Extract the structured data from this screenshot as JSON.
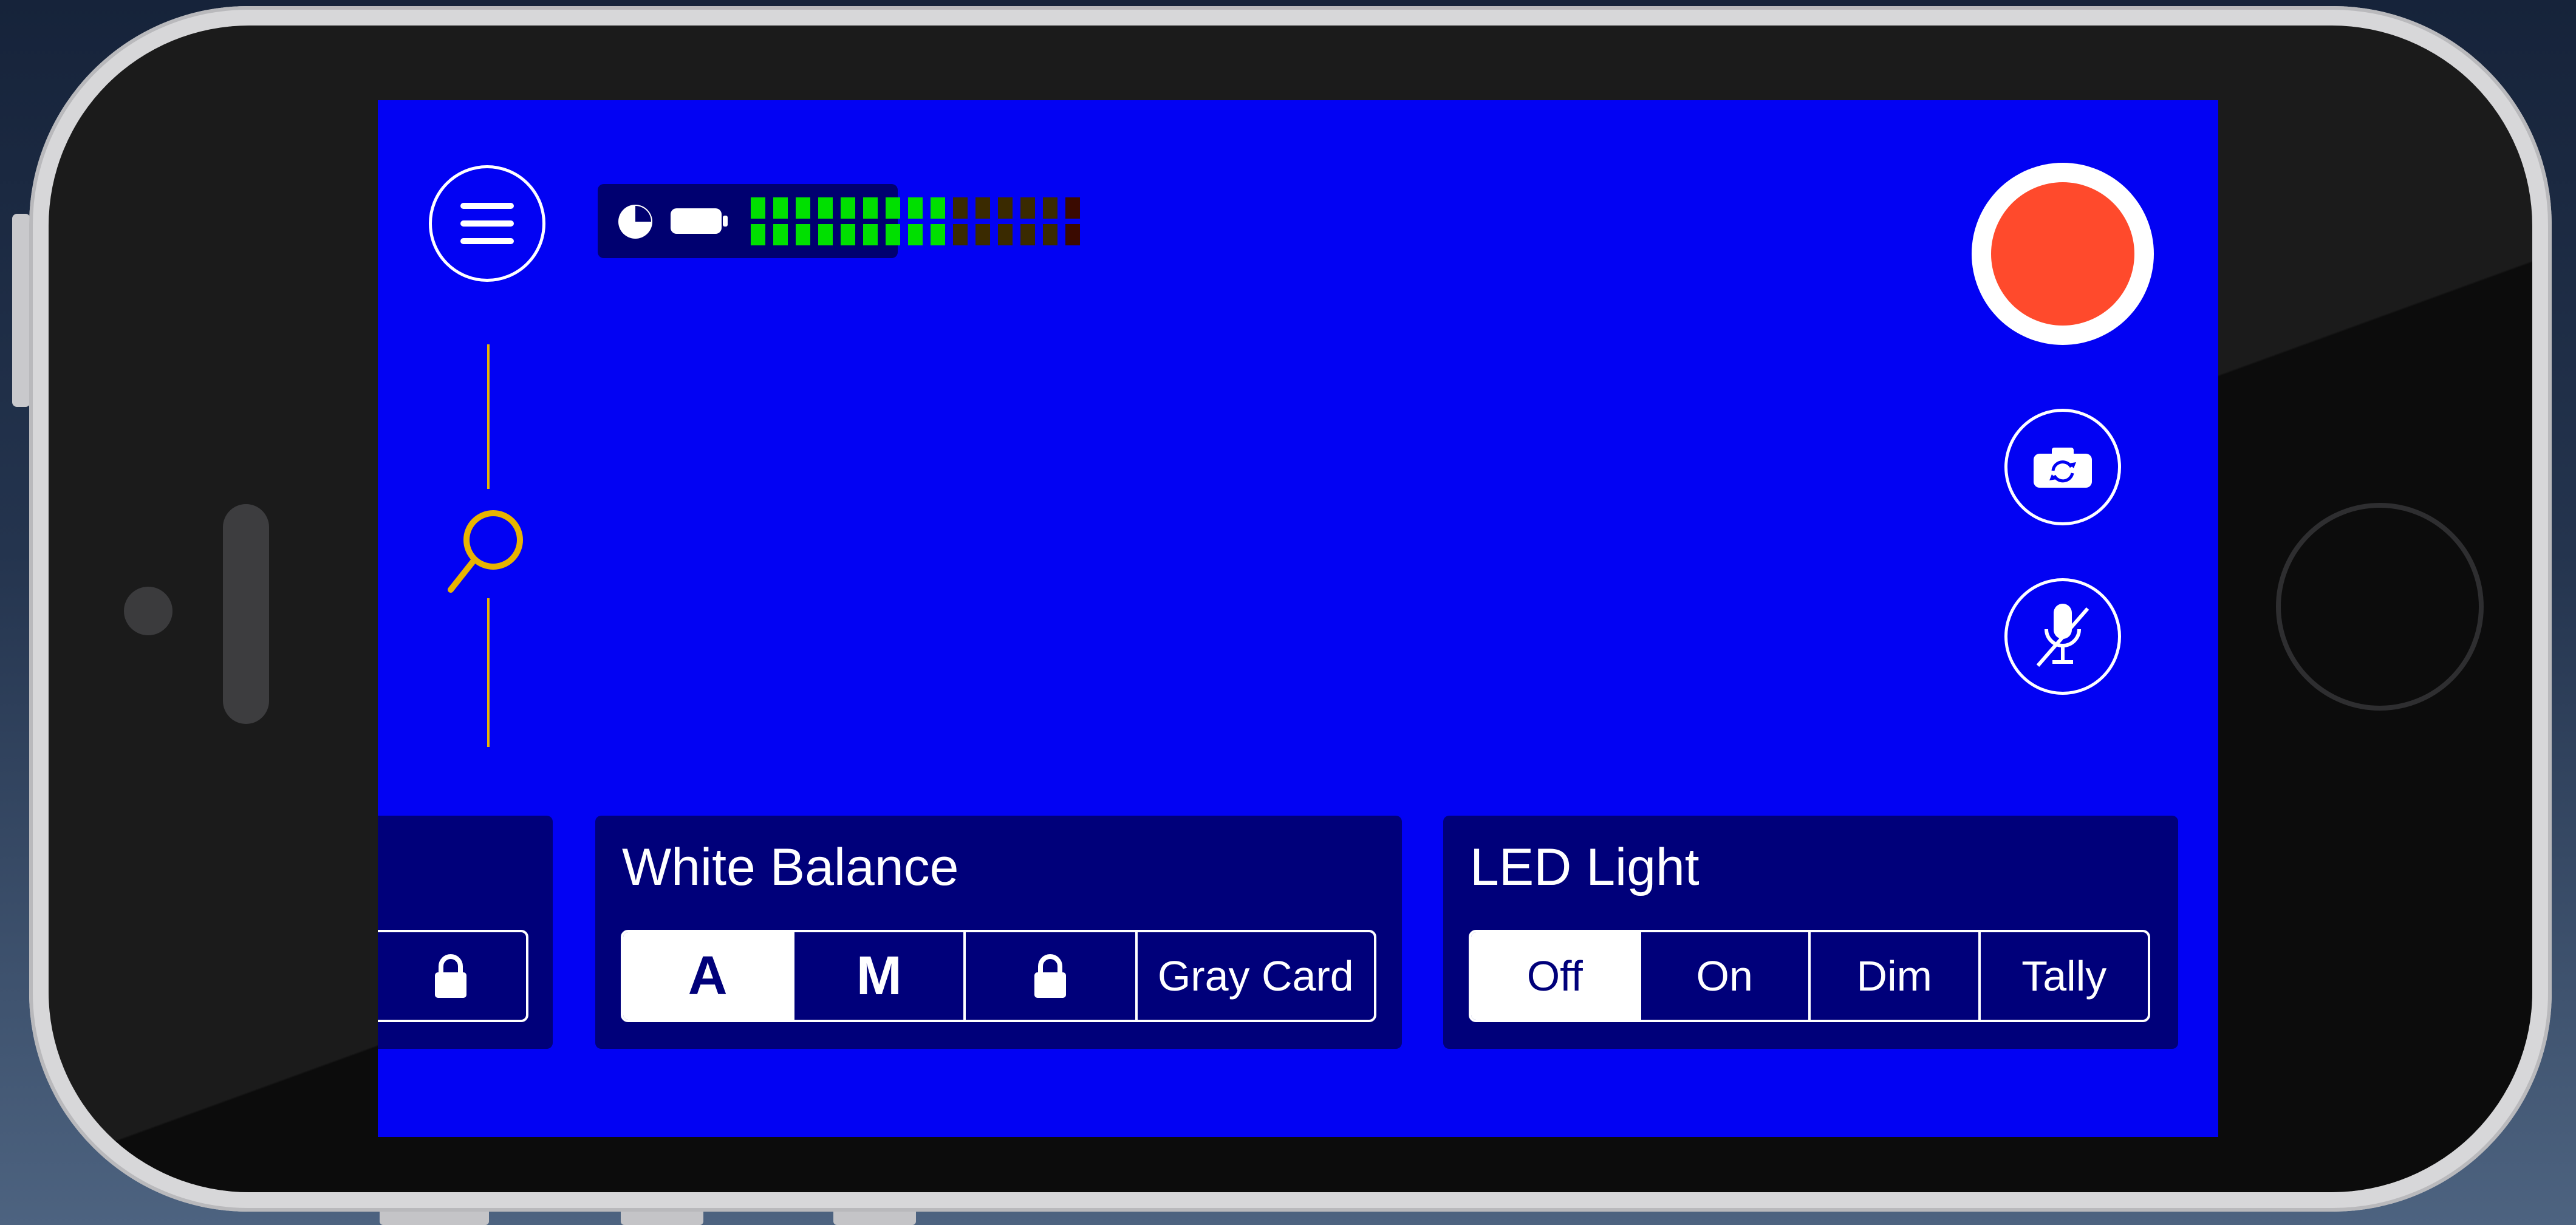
{
  "colors": {
    "screen_background": "#0202f3",
    "panel_background": "#00007a",
    "record_red": "#ff4a2c",
    "zoom_yellow": "#e8b400",
    "meter_green": "#00e000"
  },
  "toolbar": {
    "menu_icon": "hamburger-menu-icon",
    "record_icon": "record-icon",
    "flip_camera_icon": "camera-flip-icon",
    "mic_icon": "microphone-muted-icon"
  },
  "status": {
    "storage_icon": "storage-pie-icon",
    "battery_icon": "battery-icon",
    "audio_meter_level": 0.6
  },
  "zoom": {
    "icon": "zoom-magnifier-icon"
  },
  "exposure_panel": {
    "lock_icon": "lock-icon"
  },
  "white_balance": {
    "title": "White Balance",
    "options": [
      "A",
      "M",
      "",
      "Gray Card"
    ],
    "lock_icon": "lock-icon",
    "selected": "A"
  },
  "led_light": {
    "title": "LED Light",
    "options": [
      "Off",
      "On",
      "Dim",
      "Tally"
    ],
    "selected": "Off"
  }
}
